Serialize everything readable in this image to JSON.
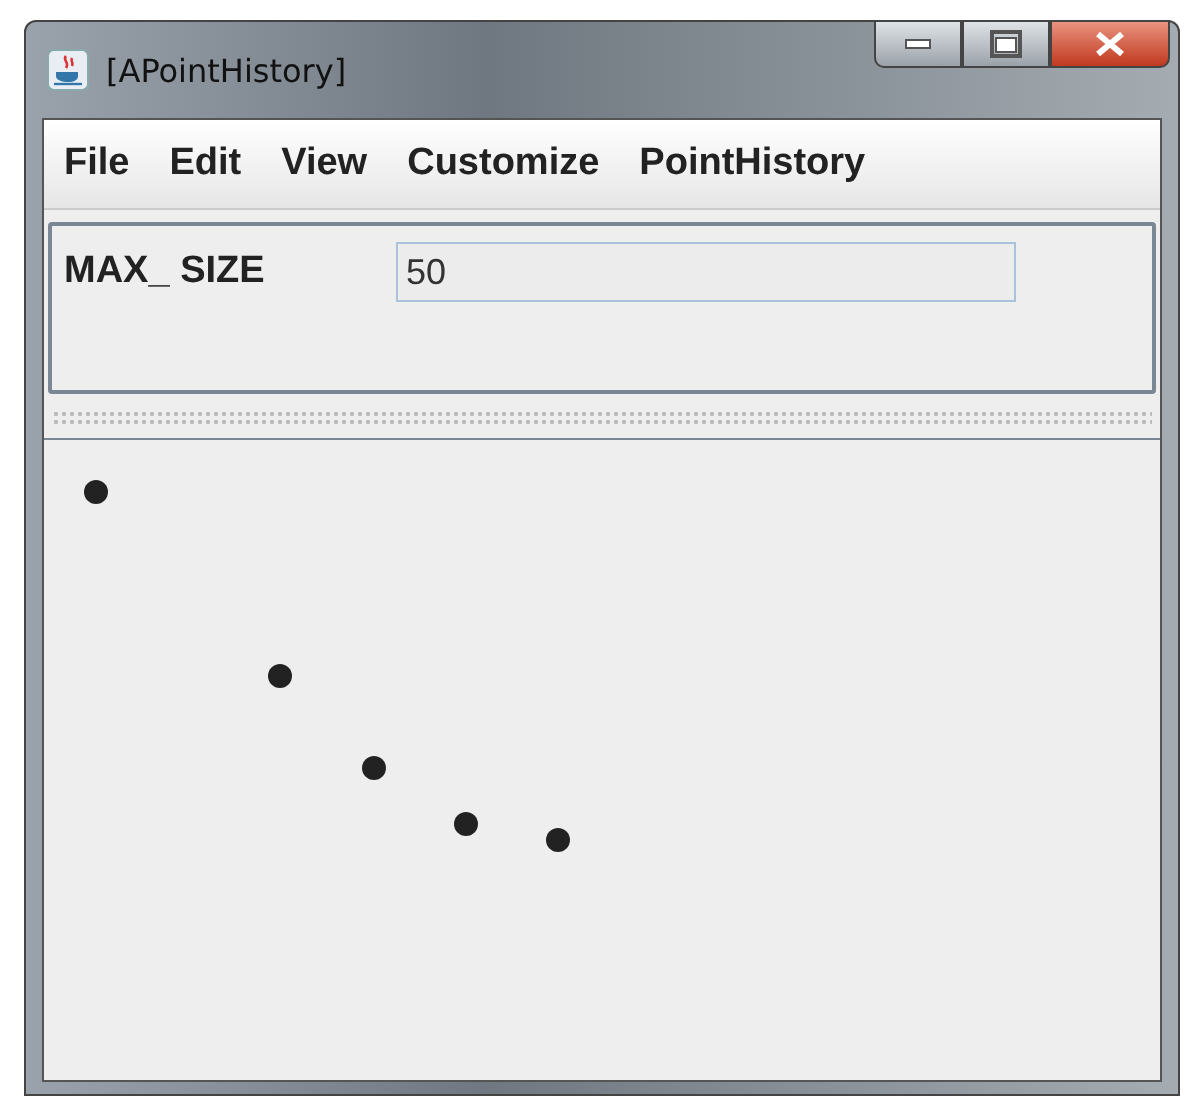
{
  "window": {
    "title": "[APointHistory]"
  },
  "menu": [
    {
      "label": "File"
    },
    {
      "label": "Edit"
    },
    {
      "label": "View"
    },
    {
      "label": "Customize"
    },
    {
      "label": "PointHistory"
    }
  ],
  "property": {
    "label": "MAX_ SIZE",
    "value": "50"
  }
}
